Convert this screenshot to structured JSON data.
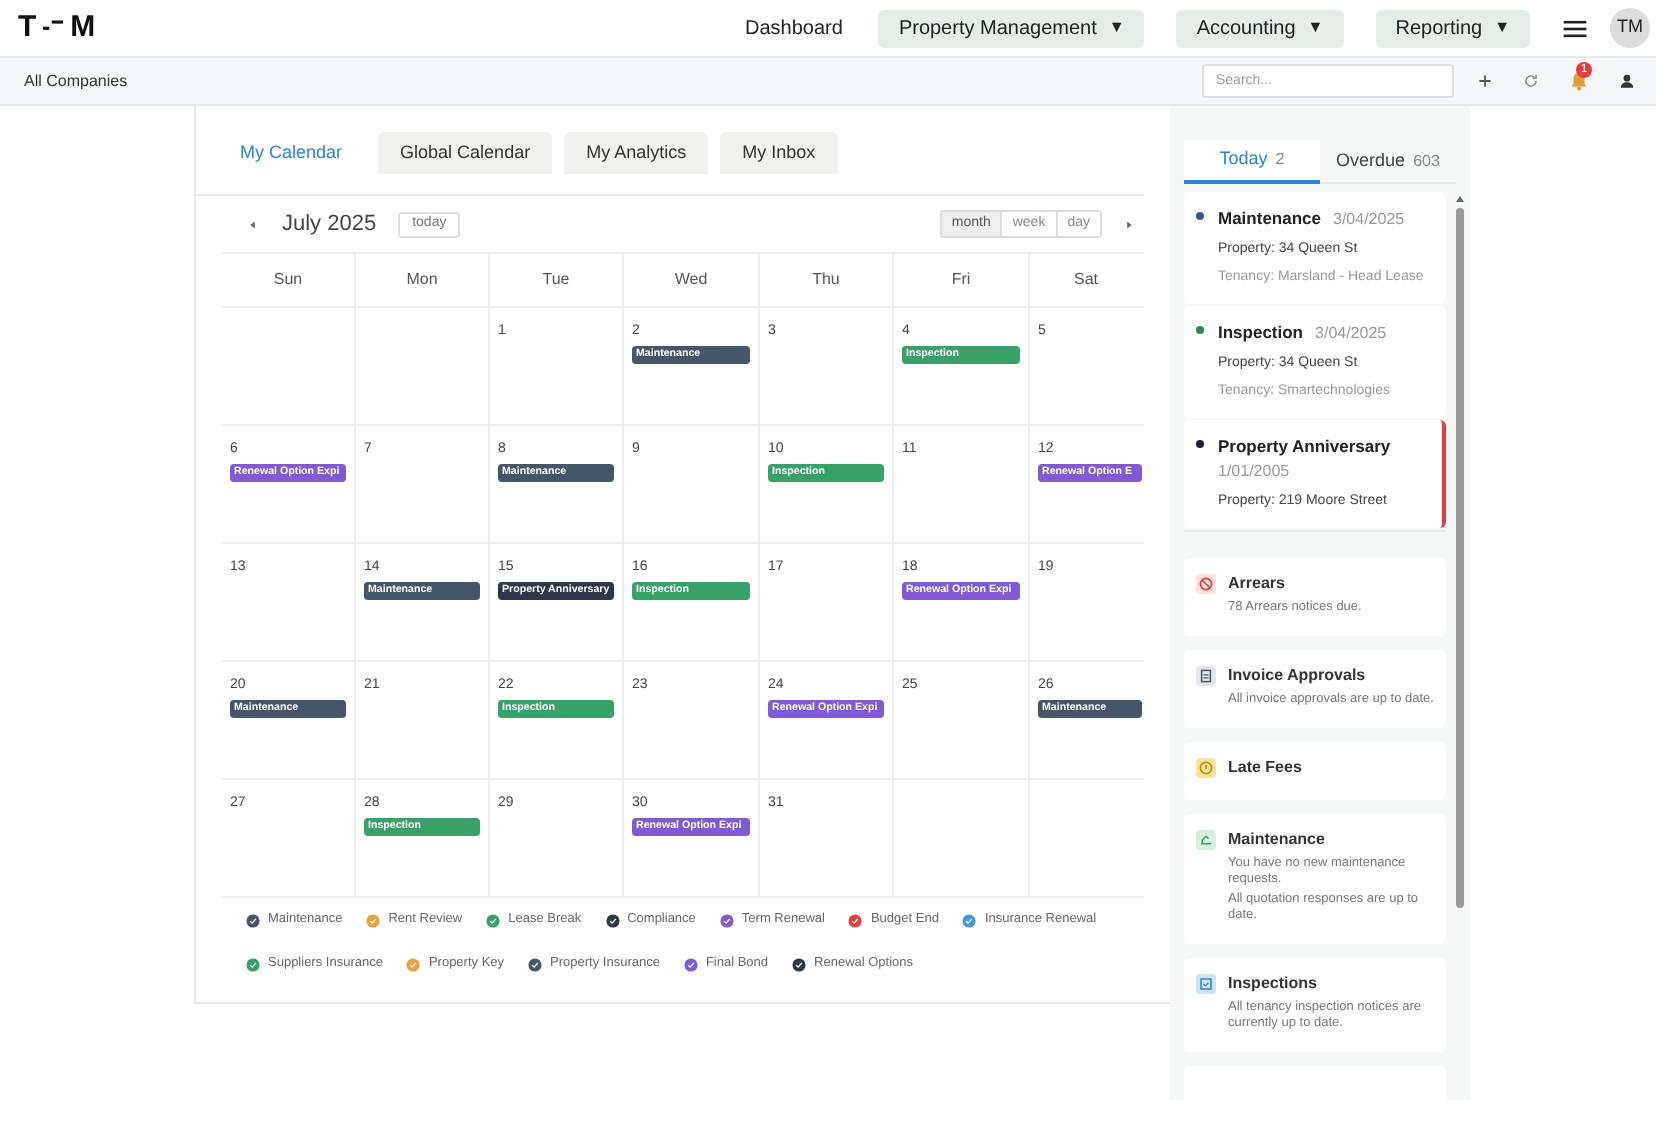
{
  "header": {
    "logo": {
      "left": "T",
      "right": "M"
    },
    "nav": [
      {
        "label": "Dashboard",
        "dropdown": false
      },
      {
        "label": "Property Management",
        "dropdown": true
      },
      {
        "label": "Accounting",
        "dropdown": true
      },
      {
        "label": "Reporting",
        "dropdown": true
      }
    ],
    "caret": "▼",
    "avatar": "TM"
  },
  "subheader": {
    "company": "All Companies",
    "search": {
      "placeholder": "Search..."
    },
    "notification_badge": "1"
  },
  "tabs": [
    {
      "label": "My Calendar",
      "selected": true
    },
    {
      "label": "Global Calendar",
      "selected": false
    },
    {
      "label": "My Analytics",
      "selected": false
    },
    {
      "label": "My Inbox",
      "selected": false
    }
  ],
  "calendar": {
    "title": "July 2025",
    "today_button": "today",
    "views": [
      {
        "label": "month",
        "selected": true
      },
      {
        "label": "week",
        "selected": false
      },
      {
        "label": "day",
        "selected": false
      }
    ],
    "weekdays": [
      "Sun",
      "Mon",
      "Tue",
      "Wed",
      "Thu",
      "Fri",
      "Sat"
    ],
    "weeks": [
      [
        {
          "kind": "blank"
        },
        {
          "kind": "blank"
        },
        {
          "kind": "day",
          "day": "1"
        },
        {
          "kind": "day",
          "day": "2",
          "events": [
            {
              "label": "Maintenance",
              "kind": "maintenance"
            }
          ]
        },
        {
          "kind": "day",
          "day": "3"
        },
        {
          "day": "4",
          "events": [
            {
              "label": "Inspection",
              "kind": "inspection"
            }
          ]
        },
        {
          "day": "5"
        }
      ],
      [
        {
          "day": "6",
          "events": [
            {
              "label": "Renewal Option Expi",
              "kind": "renewal"
            }
          ]
        },
        {
          "day": "7"
        },
        {
          "day": "8",
          "events": [
            {
              "label": "Maintenance",
              "kind": "maintenance"
            }
          ]
        },
        {
          "day": "9"
        },
        {
          "day": "10",
          "events": [
            {
              "label": "Inspection",
              "kind": "inspection"
            }
          ]
        },
        {
          "day": "11"
        },
        {
          "day": "12",
          "events": [
            {
              "label": "Renewal Option E",
              "kind": "renewal"
            }
          ]
        }
      ],
      [
        {
          "day": "13"
        },
        {
          "day": "14",
          "events": [
            {
              "label": "Maintenance",
              "kind": "maintenance"
            }
          ]
        },
        {
          "day": "15",
          "events": [
            {
              "label": "Property Anniversary",
              "kind": "anniversary"
            }
          ]
        },
        {
          "day": "16",
          "events": [
            {
              "label": "Inspection",
              "kind": "inspection"
            }
          ]
        },
        {
          "day": "17"
        },
        {
          "day": "18",
          "events": [
            {
              "label": "Renewal Option Expi",
              "kind": "renewal"
            }
          ]
        },
        {
          "day": "19"
        }
      ],
      [
        {
          "day": "20",
          "events": [
            {
              "label": "Maintenance",
              "kind": "maintenance"
            }
          ]
        },
        {
          "day": "21"
        },
        {
          "day": "22",
          "events": [
            {
              "label": "Inspection",
              "kind": "inspection"
            }
          ]
        },
        {
          "day": "23"
        },
        {
          "day": "24",
          "events": [
            {
              "label": "Renewal Option Expi",
              "kind": "renewal"
            }
          ]
        },
        {
          "day": "25"
        },
        {
          "day": "26",
          "events": [
            {
              "label": "Maintenance",
              "kind": "maintenance"
            }
          ]
        }
      ],
      [
        {
          "day": "27"
        },
        {
          "day": "28",
          "events": [
            {
              "label": "Inspection",
              "kind": "inspection"
            }
          ]
        },
        {
          "day": "29"
        },
        {
          "day": "30",
          "events": [
            {
              "label": "Renewal Option Expi",
              "kind": "renewal"
            }
          ]
        },
        {
          "day": "31"
        },
        {
          "kind": "blank"
        },
        {
          "kind": "blank"
        }
      ]
    ],
    "legend": [
      [
        {
          "label": "Maintenance",
          "color": "#4a5568"
        },
        {
          "label": "Rent Review",
          "color": "#e6a23c"
        },
        {
          "label": "Lease Break",
          "color": "#38a169"
        },
        {
          "label": "Compliance",
          "color": "#2d3748"
        },
        {
          "label": "Term Renewal",
          "color": "#805ad5"
        },
        {
          "label": "Budget End",
          "color": "#e53e3e"
        },
        {
          "label": "Insurance Renewal",
          "color": "#4299e1"
        }
      ],
      [
        {
          "label": "Suppliers Insurance",
          "color": "#38a169"
        },
        {
          "label": "Property Key",
          "color": "#e6a23c"
        },
        {
          "label": "Property Insurance",
          "color": "#4a5568"
        },
        {
          "label": "Final Bond",
          "color": "#805ad5"
        },
        {
          "label": "Renewal Options",
          "color": "#2d3748"
        }
      ]
    ]
  },
  "side_panel": {
    "tabs": [
      {
        "label": "Today",
        "count": "2",
        "selected": true
      },
      {
        "label": "Overdue",
        "count": "603",
        "selected": false
      }
    ],
    "agenda": [
      {
        "title": "Maintenance",
        "date": "3/04/2025",
        "color": "#3c5a80",
        "flagged": false,
        "lines": [
          {
            "text": "Property: 34 Queen St",
            "muted": false
          },
          {
            "text": "Tenancy: Marsland - Head Lease",
            "muted": true
          }
        ]
      },
      {
        "title": "Inspection",
        "date": "3/04/2025",
        "color": "#2f855a",
        "flagged": false,
        "lines": [
          {
            "text": "Property: 34 Queen St",
            "muted": false
          },
          {
            "text": "Tenancy: Smartechnologies",
            "muted": true
          }
        ]
      },
      {
        "title": "Property Anniversary",
        "date": "1/01/2005",
        "color": "#1a202c",
        "flagged": true,
        "lines": [
          {
            "text": "Property: 219 Moore Street",
            "muted": false
          }
        ]
      }
    ],
    "notices": [
      {
        "kind": "arrears",
        "title": "Arrears",
        "lines": [
          "78 Arrears notices due."
        ]
      },
      {
        "kind": "invoice",
        "title": "Invoice Approvals",
        "lines": [
          "All invoice approvals are up to date."
        ]
      },
      {
        "kind": "late_fees",
        "title": "Late Fees"
      },
      {
        "kind": "maintenance",
        "title": "Maintenance",
        "lines": [
          "You have no new maintenance requests.",
          "All quotation responses are up to date."
        ]
      },
      {
        "kind": "inspections",
        "title": "Inspections",
        "lines": [
          "All tenancy inspection notices are currently up to date."
        ]
      }
    ]
  }
}
